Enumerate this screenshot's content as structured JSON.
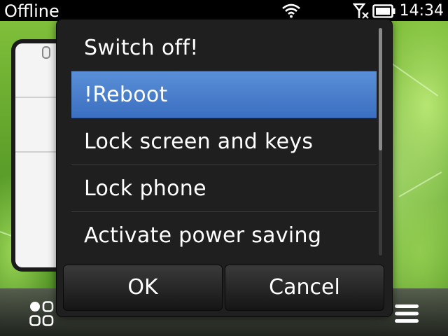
{
  "status_bar": {
    "operator": "Offline",
    "time": "14:34",
    "icons": [
      "wifi-icon",
      "no-signal-icon",
      "battery-icon"
    ]
  },
  "dialog": {
    "items": [
      {
        "label": "Switch off!",
        "highlighted": false
      },
      {
        "label": "!Reboot",
        "highlighted": true
      },
      {
        "label": "Lock screen and keys",
        "highlighted": false
      },
      {
        "label": "Lock phone",
        "highlighted": false
      },
      {
        "label": "Activate power saving",
        "highlighted": false
      }
    ],
    "ok_label": "OK",
    "cancel_label": "Cancel"
  },
  "bottom_bar": {
    "icons": [
      "apps-grid-icon",
      "options-menu-icon"
    ]
  },
  "colors": {
    "highlight": "#4a80cc",
    "dialog_bg": "#1f1f1f",
    "status_bar_bg": "#000000"
  }
}
